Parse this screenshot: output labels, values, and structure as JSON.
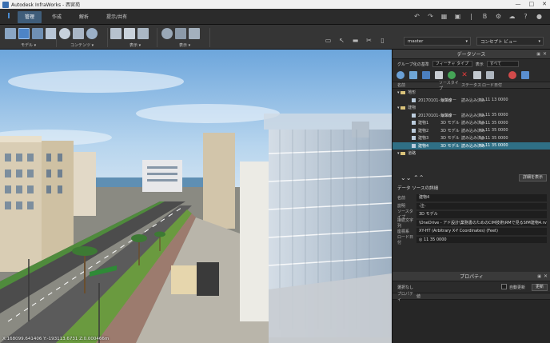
{
  "titlebar": {
    "title": "Autodesk InfraWorks - 西宮苑",
    "minimize": "—",
    "maximize": "□",
    "close": "✕"
  },
  "menubar": {
    "logo": "I",
    "tabs": [
      "管理",
      "作成",
      "解析",
      "提示/共有"
    ]
  },
  "ribbon": {
    "groups": {
      "model": "モデル ▾",
      "content": "コンテンツ ▾",
      "display": "表示 ▾",
      "viewpoint": "表示 ▾"
    },
    "model_select": "master",
    "concept_select": "コンセプト ビュー"
  },
  "viewport": {
    "coords": "X:168099.641406 Y:-193113.6731 Z:0.000466m"
  },
  "datasource": {
    "title": "データソース",
    "group_label": "グループ化の基準",
    "group_value": "フィーチャ タイプ",
    "show_label": "表示",
    "show_value": "すべて",
    "columns": [
      "名前",
      "ソースタイプ",
      "ステータス",
      "ロード日付"
    ],
    "rows": [
      {
        "type": "folder",
        "name": "地形",
        "src": "",
        "status": "",
        "date": ""
      },
      {
        "type": "item",
        "name": "20170101-海岸線",
        "src": "ラスター",
        "status": "読み込み済み",
        "date": "◎ 11 13 0000"
      },
      {
        "type": "folder",
        "name": "建物",
        "src": "",
        "status": "",
        "date": ""
      },
      {
        "type": "item",
        "name": "20170101-海岸線",
        "src": "ラスター",
        "status": "読み込み済み",
        "date": "◎ 11 35 0000"
      },
      {
        "type": "item",
        "name": "建物1",
        "src": "3D モデル",
        "status": "読み込み済み",
        "date": "◎ 11 35 0000"
      },
      {
        "type": "item",
        "name": "建物2",
        "src": "3D モデル",
        "status": "読み込み済み",
        "date": "◎ 11 35 0000"
      },
      {
        "type": "item",
        "name": "建物3",
        "src": "3D モデル",
        "status": "読み込み済み",
        "date": "◎ 11 35 0000"
      },
      {
        "type": "item",
        "name": "建物4",
        "src": "3D モデル",
        "status": "読み込み済み",
        "date": "◎ 11 35 0000",
        "selected": true
      },
      {
        "type": "folder",
        "name": "道路",
        "src": "",
        "status": "",
        "date": ""
      }
    ],
    "details_button": "詳細を表示",
    "detail_title": "データ ソースの詳細",
    "details": [
      {
        "label": "名前",
        "value": "建物4"
      },
      {
        "label": "説明",
        "value": "-注-"
      },
      {
        "label": "ソースタイプ",
        "value": "3D モデル"
      },
      {
        "label": "接続文字列",
        "value": "\\OneDrive - アド設計\\業務書のためのCIM技術\\RMで見るSfM建物4.rvt"
      },
      {
        "label": "座標系",
        "value": "XY-HT (Arbitrary X-Y Coordinates) (Feet)"
      },
      {
        "label": "ロード日付",
        "value": "◎ 11 35 0000"
      }
    ]
  },
  "properties": {
    "title": "プロパティ",
    "selection": "選択なし",
    "auto_update": "自動更新",
    "update_button": "更新",
    "columns": [
      "プロパティ",
      "値"
    ]
  },
  "colors": {
    "accent": "#3f5d7a",
    "selection": "#2f6f85",
    "panel": "#2b2b2b"
  }
}
